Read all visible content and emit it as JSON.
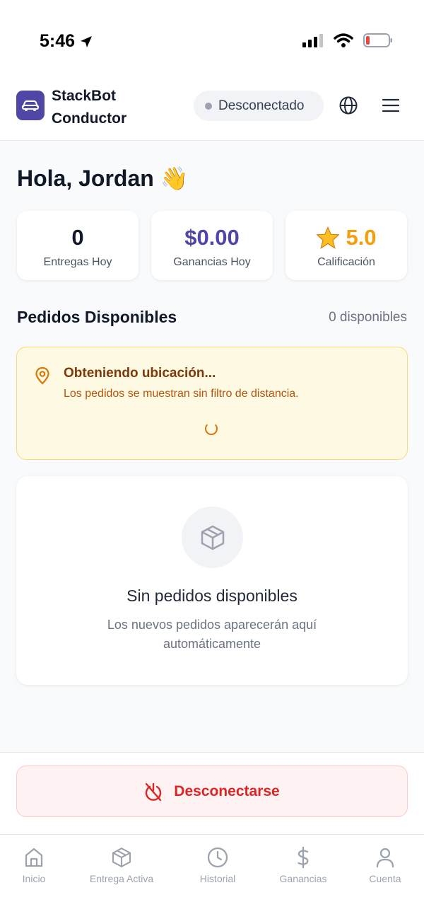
{
  "status_bar": {
    "time": "5:46"
  },
  "header": {
    "brand_line1": "StackBot",
    "brand_line2": "Conductor",
    "connection_status": "Desconectado"
  },
  "greeting": {
    "text": "Hola, Jordan",
    "emoji": "👋"
  },
  "stats": [
    {
      "value": "0",
      "label": "Entregas Hoy",
      "color": "#111827"
    },
    {
      "value": "$0.00",
      "label": "Ganancias Hoy",
      "color": "#4f46a5"
    },
    {
      "value": "5.0",
      "label": "Calificación",
      "color": "#f59e0b",
      "icon": "star-icon"
    }
  ],
  "orders": {
    "title": "Pedidos Disponibles",
    "count": "0 disponibles",
    "location_notice": {
      "title": "Obteniendo ubicación...",
      "subtitle": "Los pedidos se muestran sin filtro de distancia."
    },
    "empty_state": {
      "title": "Sin pedidos disponibles",
      "description": "Los nuevos pedidos aparecerán aquí automáticamente"
    }
  },
  "disconnect_button": {
    "label": "Desconectarse"
  },
  "bottom_nav": [
    {
      "label": "Inicio",
      "icon": "home-icon"
    },
    {
      "label": "Entrega Activa",
      "icon": "box-icon"
    },
    {
      "label": "Historial",
      "icon": "clock-icon"
    },
    {
      "label": "Ganancias",
      "icon": "dollar-icon"
    },
    {
      "label": "Cuenta",
      "icon": "user-icon"
    }
  ],
  "colors": {
    "brand": "#4f46a5",
    "danger": "#dc2626",
    "warning": "#d97706",
    "rating": "#f59e0b"
  }
}
